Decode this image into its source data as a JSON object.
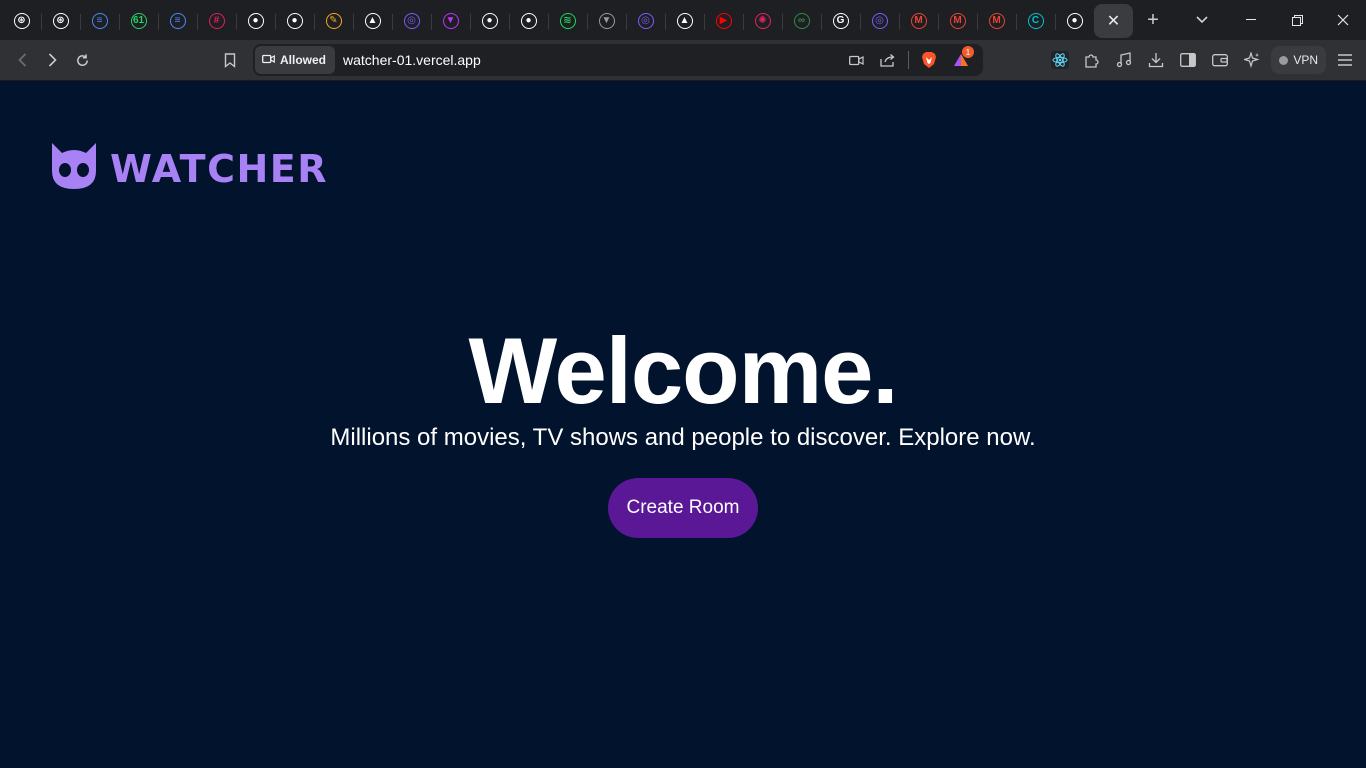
{
  "browser": {
    "tabs": [
      {
        "icon": "openai-icon",
        "color": "#ffffff",
        "glyph": "⊛"
      },
      {
        "icon": "openai-icon",
        "color": "#ffffff",
        "glyph": "⊛"
      },
      {
        "icon": "docs-icon",
        "color": "#4a8af4",
        "glyph": "≡"
      },
      {
        "icon": "whatsapp-icon",
        "color": "#25d366",
        "glyph": "61"
      },
      {
        "icon": "docs-icon",
        "color": "#4a8af4",
        "glyph": "≡"
      },
      {
        "icon": "slack-icon",
        "color": "#e01e5a",
        "glyph": "#"
      },
      {
        "icon": "github-icon",
        "color": "#ffffff",
        "glyph": "●"
      },
      {
        "icon": "github-icon",
        "color": "#ffffff",
        "glyph": "●"
      },
      {
        "icon": "pencil-icon",
        "color": "#f5a623",
        "glyph": "✎"
      },
      {
        "icon": "vercel-icon",
        "color": "#ffffff",
        "glyph": "▲"
      },
      {
        "icon": "app-icon",
        "color": "#7c5cff",
        "glyph": "◎"
      },
      {
        "icon": "vite-icon",
        "color": "#bd34fe",
        "glyph": "▼"
      },
      {
        "icon": "github-icon",
        "color": "#ffffff",
        "glyph": "●"
      },
      {
        "icon": "github-icon",
        "color": "#ffffff",
        "glyph": "●"
      },
      {
        "icon": "spotify-icon",
        "color": "#1ed760",
        "glyph": "≋"
      },
      {
        "icon": "vite-icon",
        "color": "#9a9a9a",
        "glyph": "▼"
      },
      {
        "icon": "app-icon",
        "color": "#7c5cff",
        "glyph": "◎"
      },
      {
        "icon": "vercel-icon",
        "color": "#ffffff",
        "glyph": "▲"
      },
      {
        "icon": "youtube-icon",
        "color": "#ff0000",
        "glyph": "▶"
      },
      {
        "icon": "react-icon",
        "color": "#e0245e",
        "glyph": "✺"
      },
      {
        "icon": "geeksforgeeks-icon",
        "color": "#2f8d46",
        "glyph": "∞"
      },
      {
        "icon": "google-icon",
        "color": "#ffffff",
        "glyph": "G"
      },
      {
        "icon": "app-icon",
        "color": "#7c5cff",
        "glyph": "◎"
      },
      {
        "icon": "gmail-icon",
        "color": "#ea4335",
        "glyph": "M"
      },
      {
        "icon": "gmail-icon",
        "color": "#ea4335",
        "glyph": "M"
      },
      {
        "icon": "gmail-icon",
        "color": "#ea4335",
        "glyph": "M"
      },
      {
        "icon": "canva-icon",
        "color": "#00c4cc",
        "glyph": "C"
      },
      {
        "icon": "github-icon",
        "color": "#ffffff",
        "glyph": "●"
      }
    ],
    "active_tab_close": "✕",
    "new_tab": "+",
    "permission_label": "Allowed",
    "url": "watcher-01.vercel.app",
    "shields_badge": "1",
    "vpn_label": "VPN"
  },
  "page": {
    "brand": "WATCHER",
    "brand_color": "#a882f5",
    "title": "Welcome.",
    "subtitle": "Millions of movies, TV shows and people to discover. Explore now.",
    "cta_label": "Create Room",
    "cta_color": "#5a1896",
    "background": "#02132d"
  }
}
